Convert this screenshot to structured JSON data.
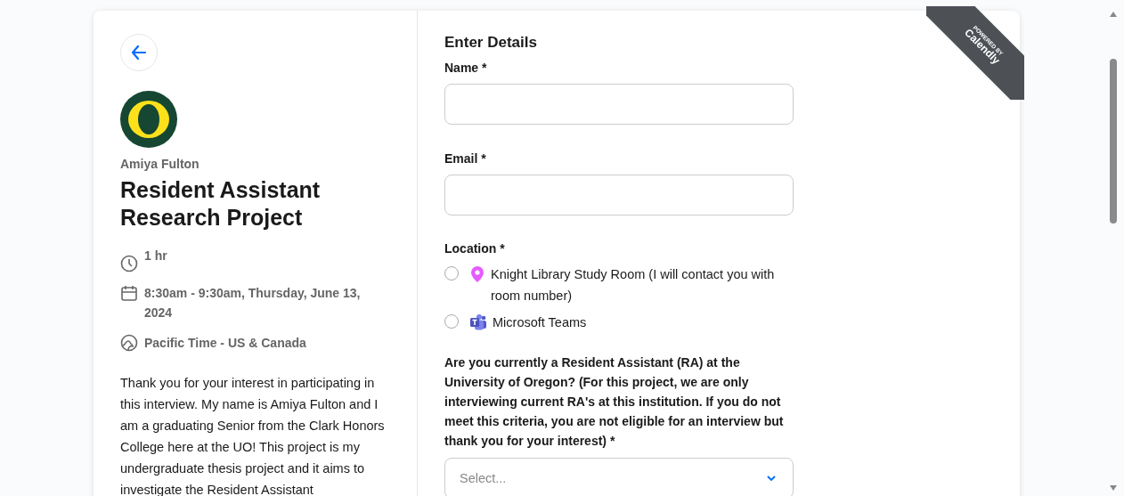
{
  "badge": {
    "line_1": "POWERED BY",
    "line_2": "Calendly"
  },
  "event": {
    "host": "Amiya Fulton",
    "title": "Resident Assistant Research Project",
    "duration": "1 hr",
    "when": "8:30am - 9:30am, Thursday, June 13, 2024",
    "timezone": "Pacific Time - US & Canada",
    "description": "Thank you for your interest in participating in this interview. My name is Amiya Fulton and I am a graduating Senior from the Clark Honors College here at the UO! This project is my undergraduate thesis project and it aims to investigate the Resident Assistant"
  },
  "form": {
    "heading": "Enter Details",
    "fields": [
      {
        "kind": "text",
        "label": "Name *"
      },
      {
        "kind": "text",
        "label": "Email *"
      }
    ],
    "location": {
      "label": "Location *",
      "options": [
        {
          "kind": "pin",
          "label": "Knight Library Study Room (I will contact you with room number)",
          "selected": false
        },
        {
          "kind": "teams",
          "label": "Microsoft Teams",
          "selected": false
        }
      ]
    },
    "question": {
      "label": "Are you currently a Resident Assistant (RA) at the University of Oregon? (For this project, we are only interviewing current RA's at this institution. If you do not meet this criteria, you are not eligible for an interview but thank you for your interest) *",
      "placeholder": "Select..."
    }
  }
}
